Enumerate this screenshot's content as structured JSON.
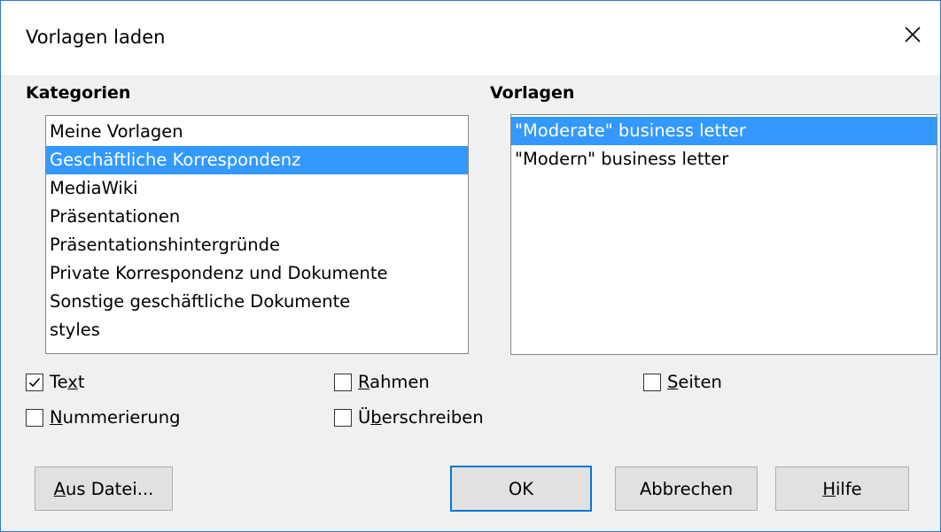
{
  "dialog": {
    "title": "Vorlagen laden",
    "close_icon": "close-icon"
  },
  "categories": {
    "label": "Kategorien",
    "items": [
      {
        "label": "Meine Vorlagen",
        "selected": false
      },
      {
        "label": "Geschäftliche Korrespondenz",
        "selected": true
      },
      {
        "label": "MediaWiki",
        "selected": false
      },
      {
        "label": "Präsentationen",
        "selected": false
      },
      {
        "label": "Präsentationshintergründe",
        "selected": false
      },
      {
        "label": "Private Korrespondenz und Dokumente",
        "selected": false
      },
      {
        "label": "Sonstige geschäftliche Dokumente",
        "selected": false
      },
      {
        "label": "styles",
        "selected": false
      }
    ]
  },
  "templates": {
    "label": "Vorlagen",
    "items": [
      {
        "label": "\"Moderate\" business letter",
        "selected": true
      },
      {
        "label": "\"Modern\" business letter",
        "selected": false
      }
    ]
  },
  "options": {
    "text": {
      "pre": "Te",
      "mnemonic": "x",
      "post": "t",
      "checked": true
    },
    "frames": {
      "pre": "",
      "mnemonic": "R",
      "post": "ahmen",
      "checked": false
    },
    "pages": {
      "pre": "",
      "mnemonic": "S",
      "post": "eiten",
      "checked": false
    },
    "numbering": {
      "pre": "",
      "mnemonic": "N",
      "post": "ummerierung",
      "checked": false
    },
    "overwrite": {
      "pre": "Ü",
      "mnemonic": "b",
      "post": "erschreiben",
      "checked": false
    }
  },
  "buttons": {
    "from_file": {
      "pre": "",
      "mnemonic": "A",
      "post": "us Datei..."
    },
    "ok": {
      "label": "OK"
    },
    "cancel": {
      "label": "Abbrechen"
    },
    "help": {
      "pre": "",
      "mnemonic": "H",
      "post": "ilfe"
    }
  },
  "colors": {
    "selection": "#3399ff",
    "default_button_border": "#0078d7",
    "window_border": "#2b79d7"
  }
}
